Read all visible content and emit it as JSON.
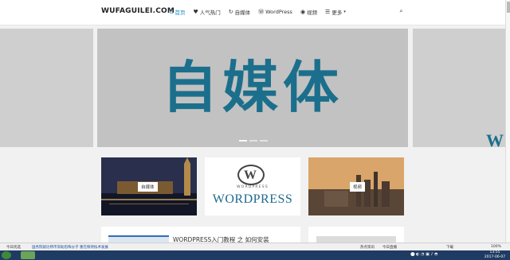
{
  "site": {
    "logo": "WUFAGUILEI.COM"
  },
  "nav": {
    "items": [
      {
        "label": "首页",
        "icon": "⌂",
        "active": true
      },
      {
        "label": "人气热门",
        "icon": "♥",
        "active": false
      },
      {
        "label": "自媒体",
        "icon": "↻",
        "active": false
      },
      {
        "label": "WordPress",
        "icon": "Ⓦ",
        "active": false
      },
      {
        "label": "视频",
        "icon": "◉",
        "active": false
      },
      {
        "label": "更多",
        "icon": "☰",
        "active": false,
        "caret": "▾"
      }
    ],
    "search_icon": "⌕"
  },
  "slider": {
    "main_text": "自媒体",
    "peek_text": "W",
    "colors": {
      "text": "#1b6f8c",
      "bg": "#c2c2c2"
    }
  },
  "cards": [
    {
      "label": "自媒体"
    },
    {
      "small": "WORDPRESS",
      "big": "WORDPRESS",
      "logo": "W"
    },
    {
      "label": "视频"
    }
  ],
  "articles": [
    {
      "title": "WORDPRESS入门教程 之 如何安装"
    }
  ],
  "status": {
    "left_a": "今日优选",
    "left_b": "国务院就比特币资助恐怖分子 重在保持技术发展",
    "right_a": "热点资讯",
    "right_b": "今日直播",
    "right_c": "下载",
    "zoom": "100%"
  },
  "taskbar": {
    "time": "13:55",
    "date": "2017-06-07"
  }
}
